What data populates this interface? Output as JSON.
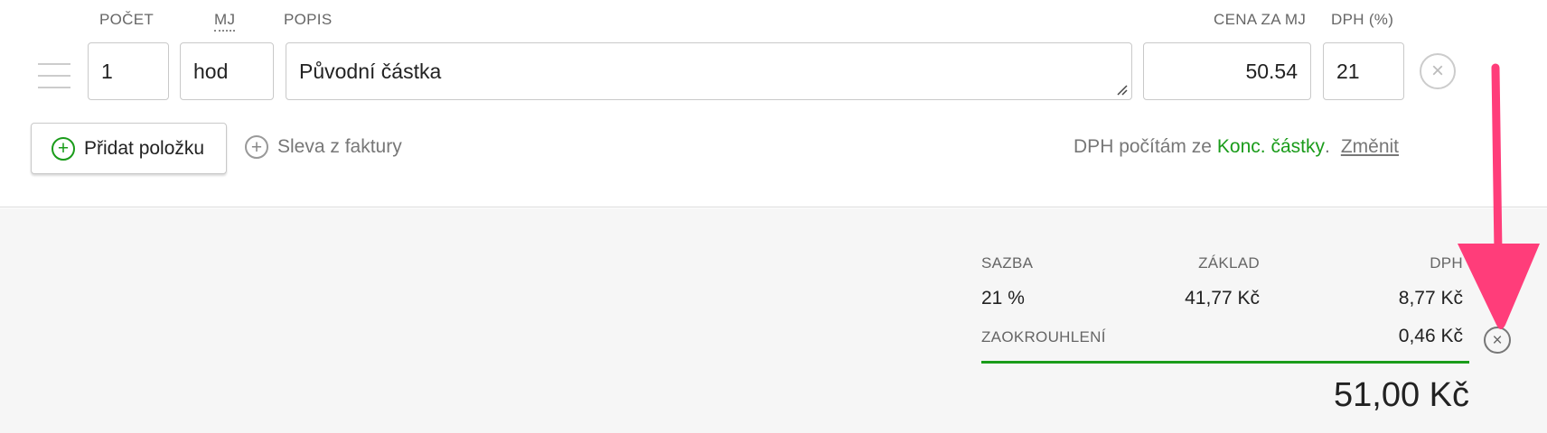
{
  "columns": {
    "quantity": "POČET",
    "unit": "MJ",
    "description": "POPIS",
    "unit_price": "CENA ZA MJ",
    "vat": "DPH (%)"
  },
  "item": {
    "quantity": "1",
    "unit": "hod",
    "description": "Původní částka",
    "unit_price": "50.54",
    "vat": "21"
  },
  "actions": {
    "add_item": "Přidat položku",
    "invoice_discount": "Sleva z faktury"
  },
  "vat_info": {
    "prefix": "DPH počítám ze",
    "mode": "Konc. částky",
    "dot": ".",
    "change": "Změnit"
  },
  "summary": {
    "headers": {
      "rate": "SAZBA",
      "base": "ZÁKLAD",
      "vat": "DPH"
    },
    "row": {
      "rate": "21 %",
      "base": "41,77 Kč",
      "vat": "8,77 Kč"
    },
    "rounding_label": "ZAOKROUHLENÍ",
    "rounding_value": "0,46 Kč",
    "total": "51,00 Kč"
  },
  "icons": {
    "drag": "drag-handle-icon",
    "remove": "close-icon",
    "add": "plus-circle-icon",
    "annotation": "arrow-down-annotation"
  },
  "colors": {
    "accent_green": "#1a9c1a",
    "annotation_pink": "#ff3d7a"
  }
}
